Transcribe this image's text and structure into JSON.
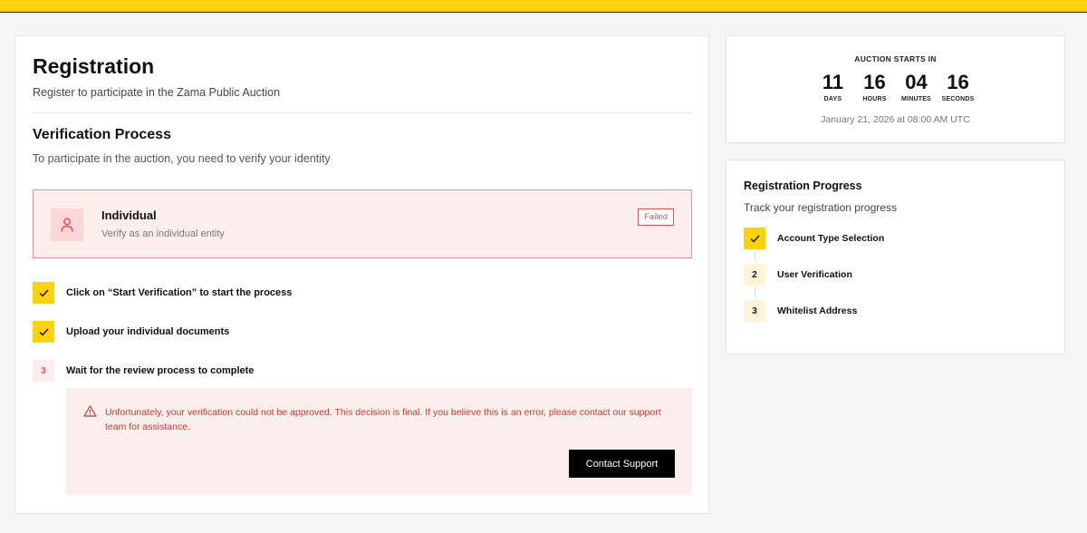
{
  "registration": {
    "title": "Registration",
    "subtitle": "Register to participate in the Zama Public Auction"
  },
  "verification": {
    "title": "Verification Process",
    "description": "To participate in the auction, you need to verify your identity",
    "entity": {
      "title": "Individual",
      "description": "Verify as an individual entity",
      "status": "Failed",
      "icon": "user-icon"
    },
    "steps": [
      {
        "marker": "",
        "label": "Click on “Start Verification” to start the process",
        "state": "done"
      },
      {
        "marker": "",
        "label": "Upload your individual documents",
        "state": "done"
      },
      {
        "marker": "3",
        "label": "Wait for the review process to complete",
        "state": "failed"
      }
    ],
    "error": {
      "message": "Unfortunately, your verification could not be approved. This decision is final. If you believe this is an error, please contact our support team for assistance.",
      "button_label": "Contact Support",
      "icon": "warning-icon"
    }
  },
  "countdown": {
    "heading": "AUCTION STARTS IN",
    "units": [
      {
        "value": "11",
        "label": "DAYS"
      },
      {
        "value": "16",
        "label": "HOURS"
      },
      {
        "value": "04",
        "label": "MINUTES"
      },
      {
        "value": "16",
        "label": "SECONDS"
      }
    ],
    "date": "January 21, 2026 at 08:00 AM UTC"
  },
  "progress": {
    "title": "Registration Progress",
    "description": "Track your registration progress",
    "steps": [
      {
        "marker": "",
        "label": "Account Type Selection",
        "state": "done"
      },
      {
        "marker": "2",
        "label": "User Verification",
        "state": "pending"
      },
      {
        "marker": "3",
        "label": "Whitelist Address",
        "state": "pending"
      }
    ]
  },
  "colors": {
    "accent": "#ffd209",
    "error": "#d9534f",
    "error_bg": "#fdeeee"
  }
}
